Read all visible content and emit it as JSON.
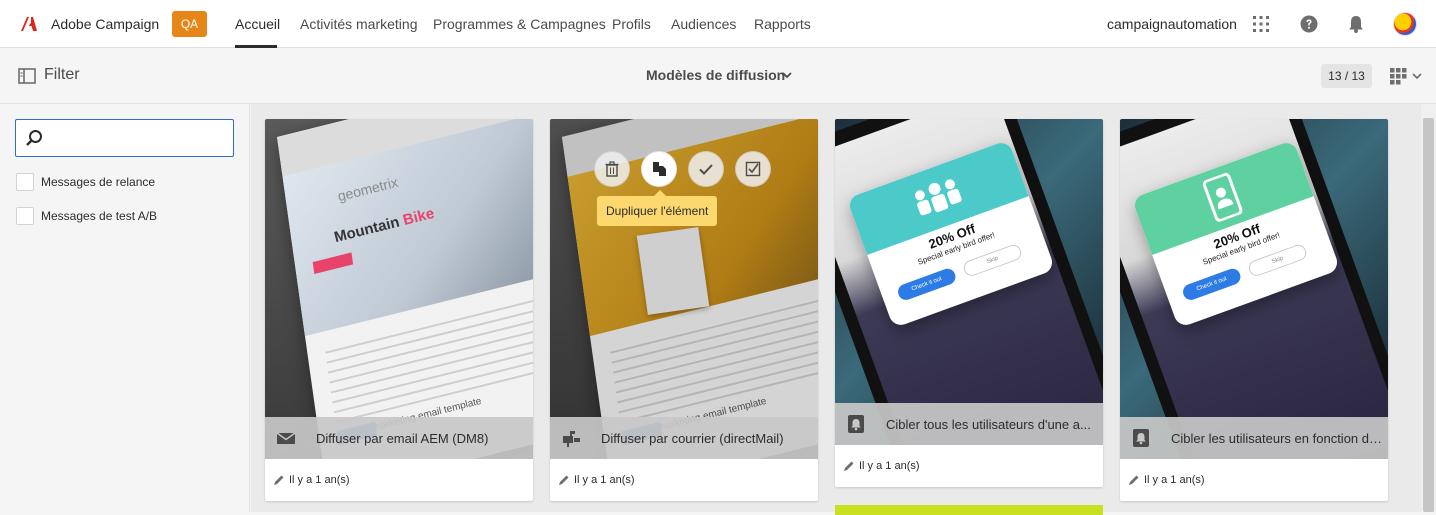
{
  "app": {
    "brand": "Adobe Campaign",
    "env_badge": "QA",
    "user": "campaignautomation"
  },
  "nav": {
    "items": [
      {
        "label": "Accueil",
        "active": true
      },
      {
        "label": "Activités marketing",
        "active": false
      },
      {
        "label": "Programmes & Campagnes",
        "active": false
      },
      {
        "label": "Profils",
        "active": false
      },
      {
        "label": "Audiences",
        "active": false
      },
      {
        "label": "Rapports",
        "active": false
      }
    ]
  },
  "toolbar": {
    "filter_label": "Filter",
    "view_title": "Modèles de diffusion",
    "count": "13 / 13"
  },
  "sidebar": {
    "search": {
      "value": "",
      "placeholder": ""
    },
    "filters": [
      {
        "label": "Messages de relance",
        "checked": false
      },
      {
        "label": "Messages de test A/B",
        "checked": false
      }
    ]
  },
  "cards": [
    {
      "title": "Diffuser par email AEM (DM8)",
      "modified": "Il y a 1 an(s)",
      "icon": "mail-icon",
      "art": "email"
    },
    {
      "title": "Diffuser par courrier (directMail)",
      "modified": "Il y a 1 an(s)",
      "icon": "direct-mail-icon",
      "art": "email"
    },
    {
      "title": "Cibler tous les utilisateurs d'une a...",
      "modified": "Il y a 1 an(s)",
      "icon": "push-notification-icon",
      "art": "phone"
    },
    {
      "title": "Cibler les utilisateurs en fonction de l...",
      "modified": "Il y a 1 an(s)",
      "icon": "push-notification-icon",
      "art": "phone"
    }
  ],
  "hover_card": {
    "tooltip": "Dupliquer l'élément",
    "actions": [
      "delete-icon",
      "duplicate-icon",
      "approve-icon",
      "select-icon"
    ]
  },
  "promo": {
    "title": "20% Off",
    "subtitle": "Special early bird offer!",
    "cta": "Check it out",
    "skip": "Skip"
  },
  "email_art": {
    "brand": "geometrix",
    "headline_1": "Mountain",
    "headline_2": "Bike",
    "tagline": "minimal and responsive marketing email template"
  },
  "colors": {
    "accent_badge": "#e68619",
    "tooltip": "#fdd86e",
    "promo_teal": "#4cc9c9",
    "promo_green": "#5fd1a1",
    "cta_blue": "#2d7be5"
  }
}
